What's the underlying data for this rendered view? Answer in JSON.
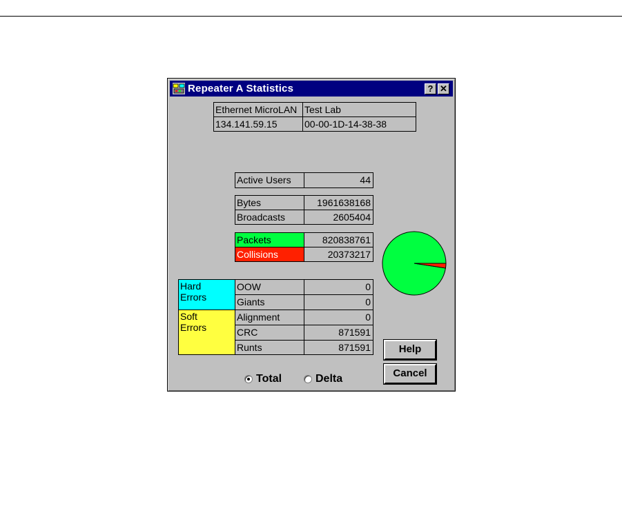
{
  "window": {
    "title": "Repeater A Statistics",
    "help_btn": "?",
    "close_btn": "✕"
  },
  "info": {
    "row1": [
      "Ethernet MicroLAN",
      "Test Lab"
    ],
    "row2": [
      "134.141.59.15",
      "00-00-1D-14-38-38"
    ]
  },
  "stats": {
    "active_users": {
      "label": "Active Users",
      "value": "44"
    },
    "bytes": {
      "label": "Bytes",
      "value": "1961638168"
    },
    "broadcasts": {
      "label": "Broadcasts",
      "value": "2605404"
    },
    "packets": {
      "label": "Packets",
      "value": "820838761",
      "color": "#00ff40"
    },
    "collisions": {
      "label": "Collisions",
      "value": "20373217",
      "color": "#ff2000"
    }
  },
  "errors": {
    "hard_label": "Hard\nErrors",
    "soft_label": "Soft\nErrors",
    "hard_color": "#00ffff",
    "soft_color": "#ffff40",
    "oow": {
      "label": "OOW",
      "value": "0"
    },
    "giants": {
      "label": "Giants",
      "value": "0"
    },
    "alignment": {
      "label": "Alignment",
      "value": "0"
    },
    "crc": {
      "label": "CRC",
      "value": "871591"
    },
    "runts": {
      "label": "Runts",
      "value": "871591"
    }
  },
  "buttons": {
    "help": "Help",
    "cancel": "Cancel"
  },
  "mode": {
    "total": "Total",
    "delta": "Delta",
    "selected": "total"
  },
  "chart_data": {
    "type": "pie",
    "slices": [
      {
        "label": "Packets",
        "value": 820838761,
        "color": "#00ff40"
      },
      {
        "label": "Collisions",
        "value": 20373217,
        "color": "#ff2000"
      }
    ]
  }
}
